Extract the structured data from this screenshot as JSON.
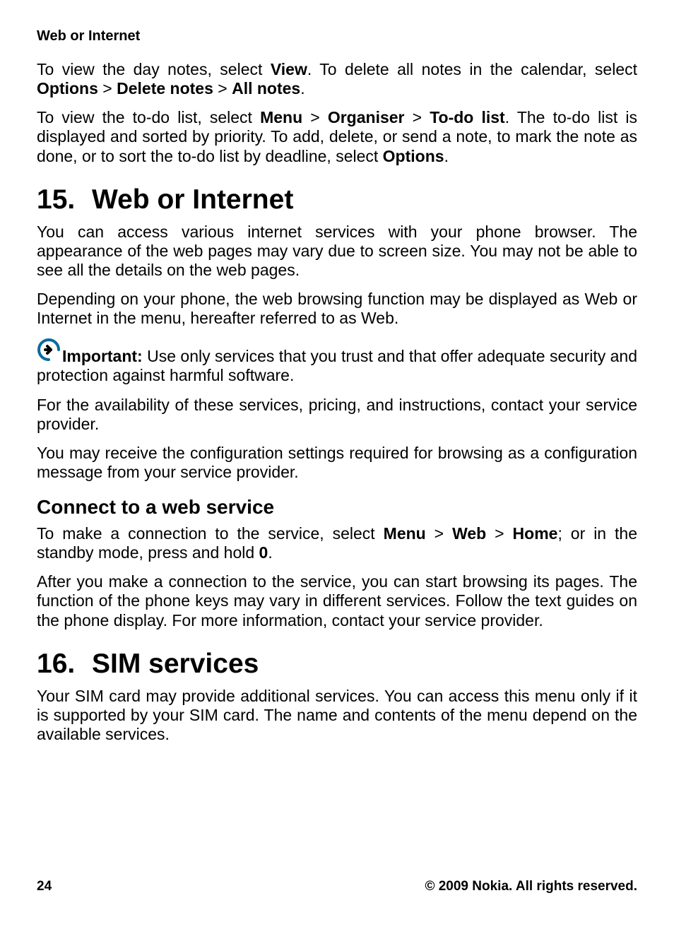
{
  "header": "Web or Internet",
  "intro": {
    "p1a": "To view the day notes, select ",
    "p1b": "View",
    "p1c": ". To delete all notes in the calendar, select ",
    "p1d": "Options",
    "p1e": " > ",
    "p1f": "Delete notes",
    "p1g": " > ",
    "p1h": "All notes",
    "p1i": ".",
    "p2a": "To view the to-do list, select ",
    "p2b": "Menu",
    "p2c": " > ",
    "p2d": "Organiser",
    "p2e": " > ",
    "p2f": "To-do list",
    "p2g": ". The to-do list is displayed and sorted by priority. To add, delete, or send a note, to mark the note as done, or to sort the to-do list by deadline, select ",
    "p2h": "Options",
    "p2i": "."
  },
  "s15": {
    "num": "15.",
    "title": "Web or Internet",
    "p1": "You can access various internet services with your phone browser. The appearance of the web pages may vary due to screen size. You may not be able to see all the details on the web pages.",
    "p2": "Depending on your phone, the web browsing function may be displayed as Web or Internet in the menu, hereafter referred to as Web.",
    "imp_label": "Important:",
    "imp_text": "  Use only services that you trust and that offer adequate security and protection against harmful software.",
    "p3": "For the availability of these services, pricing, and instructions, contact your service provider.",
    "p4": "You may receive the configuration settings required for browsing as a configuration message from your service provider.",
    "sub": {
      "title": "Connect to a web service",
      "p1a": "To make a connection to the service, select ",
      "p1b": "Menu",
      "p1c": " > ",
      "p1d": "Web",
      "p1e": " > ",
      "p1f": "Home",
      "p1g": "; or in the standby mode, press and hold ",
      "p1h": "0",
      "p1i": ".",
      "p2": "After you make a connection to the service, you can start browsing its pages. The function of the phone keys may vary in different services. Follow the text guides on the phone display. For more information, contact your service provider."
    }
  },
  "s16": {
    "num": "16.",
    "title": "SIM services",
    "p1": "Your SIM card may provide additional services. You can access this menu only if it is supported by your SIM card. The name and contents of the menu depend on the available services."
  },
  "footer": {
    "page": "24",
    "copyright": "© 2009 Nokia. All rights reserved."
  }
}
